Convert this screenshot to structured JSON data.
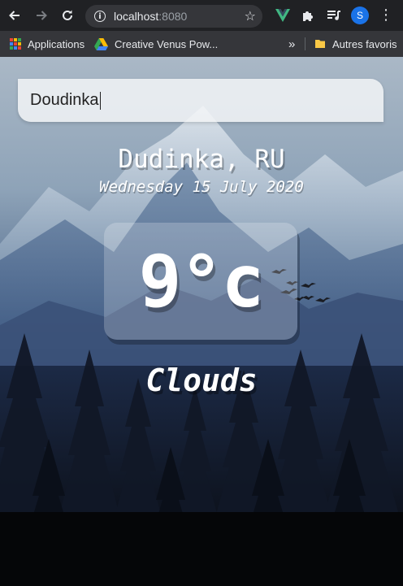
{
  "browser": {
    "url_host": "localhost",
    "url_port": ":8080",
    "profile_initial": "S",
    "bookmarks": [
      {
        "label": "Applications"
      },
      {
        "label": "Creative Venus Pow..."
      },
      {
        "label": "Autres favoris"
      }
    ],
    "overflow_label": "»",
    "colors": {
      "chrome": "#202124",
      "bar": "#35363a",
      "vue_green": "#41b883",
      "profile_blue": "#1a73e8"
    }
  },
  "app": {
    "search": {
      "value": "Doudinka"
    },
    "location": "Dudinka, RU",
    "date": "Wednesday 15 July 2020",
    "temperature": "9°c",
    "weather": "Clouds"
  }
}
